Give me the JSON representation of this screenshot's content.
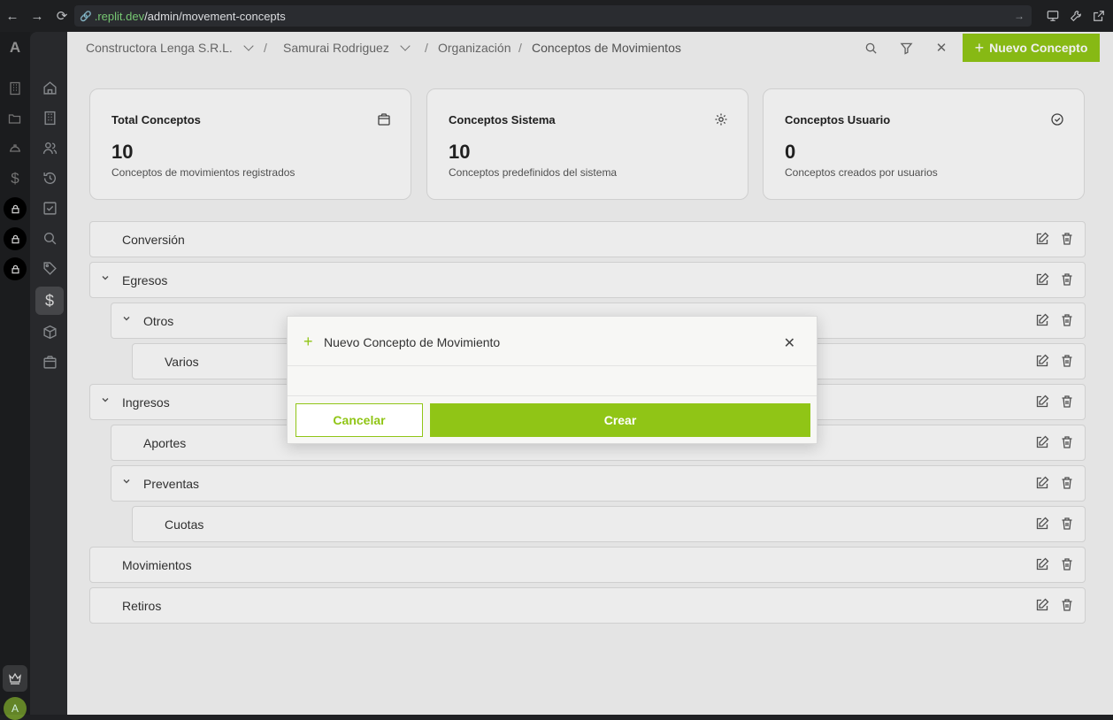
{
  "browser": {
    "url_prefix": ".replit.dev",
    "url_path": "/admin/movement-concepts"
  },
  "header": {
    "company": "Constructora Lenga S.R.L.",
    "user": "Samurai Rodriguez",
    "section": "Organización",
    "page": "Conceptos de Movimientos",
    "new_button": "Nuevo Concepto"
  },
  "rail": {
    "logo": "A",
    "avatar": "A"
  },
  "stats": [
    {
      "title": "Total Conceptos",
      "value": "10",
      "desc": "Conceptos de movimientos registrados",
      "icon": "package-icon"
    },
    {
      "title": "Conceptos Sistema",
      "value": "10",
      "desc": "Conceptos predefinidos del sistema",
      "icon": "gear-icon"
    },
    {
      "title": "Conceptos Usuario",
      "value": "0",
      "desc": "Conceptos creados por usuarios",
      "icon": "check-circle-icon"
    }
  ],
  "concepts": [
    {
      "label": "Conversión",
      "level": 0,
      "expandable": false
    },
    {
      "label": "Egresos",
      "level": 0,
      "expandable": true
    },
    {
      "label": "Otros",
      "level": 1,
      "expandable": true
    },
    {
      "label": "Varios",
      "level": 2,
      "expandable": false
    },
    {
      "label": "Ingresos",
      "level": 0,
      "expandable": true
    },
    {
      "label": "Aportes",
      "level": 1,
      "expandable": false
    },
    {
      "label": "Preventas",
      "level": 1,
      "expandable": true
    },
    {
      "label": "Cuotas",
      "level": 2,
      "expandable": false
    },
    {
      "label": "Movimientos",
      "level": 0,
      "expandable": false
    },
    {
      "label": "Retiros",
      "level": 0,
      "expandable": false
    }
  ],
  "modal": {
    "title": "Nuevo Concepto de Movimiento",
    "cancel": "Cancelar",
    "create": "Crear"
  },
  "colors": {
    "accent": "#90c516",
    "background": "#f3f3f3",
    "sidebar": "#2b2c2f"
  }
}
